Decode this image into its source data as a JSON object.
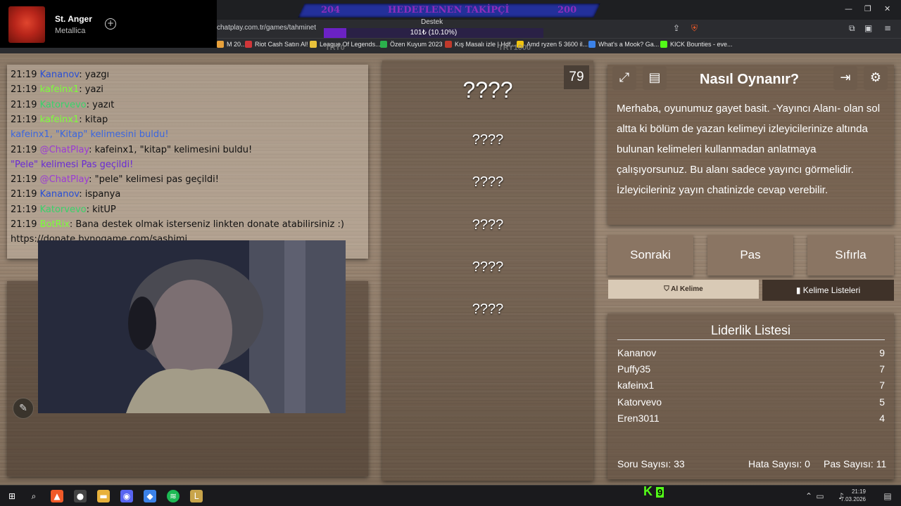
{
  "music": {
    "track": "St. Anger",
    "artist": "Metallica"
  },
  "browser": {
    "url": "chatplay.com.tr/games/tahminet",
    "bookmarks": [
      {
        "label": "M 20...",
        "color": "#e8a13b"
      },
      {
        "label": "Riot Cash Satın Al!",
        "color": "#d13639"
      },
      {
        "label": "League Of Legends...",
        "color": "#e8c13b"
      },
      {
        "label": "Özen Kuyum 2023",
        "color": "#2bb24c"
      },
      {
        "label": "Kış Masalı izle | Hdf...",
        "color": "#c0392b"
      },
      {
        "label": "Amd ryzen 5 3600 il...",
        "color": "#f1c40f"
      },
      {
        "label": "What's a Mook? Ga...",
        "color": "#3b82e8"
      },
      {
        "label": "KICK Bounties - eve...",
        "color": "#53fc18"
      }
    ]
  },
  "goal": {
    "left": "204",
    "title": "HEDEFLENEN TAKİPÇİ",
    "right": "200"
  },
  "support": {
    "label": "Destek",
    "text": "101₺ (10.10%)",
    "fraction": 0.101,
    "ghost_left": "TRY0",
    "ghost_right": "TRY1000"
  },
  "chat": [
    {
      "time": "21:19",
      "user": "Kananov",
      "ucolor": "#2a4fd6",
      "msg": ": yazgı"
    },
    {
      "time": "21:19",
      "user": "kafeinx1",
      "ucolor": "#7cff3a",
      "msg": ": yazi"
    },
    {
      "time": "21:19",
      "user": "Katorvevo",
      "ucolor": "#3ad36a",
      "msg": ": yazıt"
    },
    {
      "time": "21:19",
      "user": "kafeinx1",
      "ucolor": "#7cff3a",
      "msg": ": kitap"
    },
    {
      "time": "",
      "user": "",
      "ucolor": "#2a4fd6",
      "msg": "kafeinx1, \"Kitap\" kelimesini buldu!",
      "special": "#3b66e0"
    },
    {
      "time": "21:19",
      "user": "@ChatPlay",
      "ucolor": "#9b3ad6",
      "msg": ": kafeinx1, \"kitap\" kelimesini buldu!"
    },
    {
      "time": "",
      "user": "",
      "ucolor": "#e23a3a",
      "msg": "\"Pele\" kelimesi Pas geçildi!",
      "special": "#6a2ad6"
    },
    {
      "time": "21:19",
      "user": "@ChatPlay",
      "ucolor": "#9b3ad6",
      "msg": ": \"pele\" kelimesi pas geçildi!"
    },
    {
      "time": "21:19",
      "user": "Kananov",
      "ucolor": "#2a4fd6",
      "msg": ": ispanya"
    },
    {
      "time": "21:19",
      "user": "Katorvevo",
      "ucolor": "#3ad36a",
      "msg": ": kitUP"
    },
    {
      "time": "21:19",
      "user": "BotRix",
      "ucolor": "#7cff3a",
      "msg": ": Bana destek olmak isterseniz linkten donate atabilirsiniz :)"
    },
    {
      "time": "",
      "user": "",
      "ucolor": "#111",
      "msg": "https://donate.bynogame.com/sashimi"
    }
  ],
  "questions": {
    "counter": "79",
    "items": [
      "????",
      "????",
      "????",
      "????",
      "????",
      "????"
    ]
  },
  "howto": {
    "title": "Nasıl Oynanır?",
    "text": "Merhaba, oyunumuz gayet basit. -Yayıncı Alanı- olan sol altta ki bölüm de yazan kelimeyi izleyicilerinize altında bulunan kelimeleri kullanmadan anlatmaya çalışıyorsunuz. Bu alanı sadece yayıncı görmelidir. İzleyicileriniz yayın chatinizde cevap verebilir."
  },
  "buttons": {
    "next": "Sonraki",
    "pass": "Pas",
    "reset": "Sıfırla",
    "ai": "Al Kelime",
    "lists": "Kelime Listeleri"
  },
  "leaderboard": {
    "title": "Liderlik Listesi",
    "rows": [
      {
        "name": "Kananov",
        "score": "9"
      },
      {
        "name": "Puffy35",
        "score": "7"
      },
      {
        "name": "kafeinx1",
        "score": "7"
      },
      {
        "name": "Katorvevo",
        "score": "5"
      },
      {
        "name": "Eren3011",
        "score": "4"
      }
    ]
  },
  "stats": {
    "questions": "Soru Sayısı: 33",
    "errors": "Hata Sayısı: 0",
    "passes": "Pas Sayısı: 11"
  },
  "taskbar": {
    "time": "21:19",
    "date": "7.03.2026",
    "kick_count": "9"
  }
}
